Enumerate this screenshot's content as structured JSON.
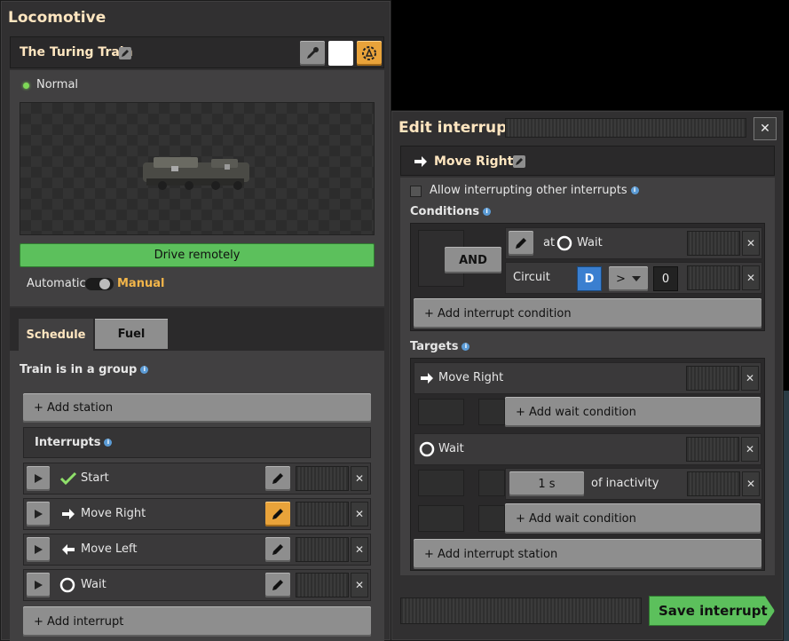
{
  "locomotive": {
    "window_title": "Locomotive",
    "train_name": "The Turing Train",
    "status": "Normal",
    "status_color": "#7ed957",
    "drive_remotely": "Drive remotely",
    "mode_automatic": "Automatic",
    "mode_manual": "Manual",
    "tabs": [
      {
        "label": "Schedule"
      },
      {
        "label": "Fuel"
      }
    ],
    "group_text": "Train is in a group",
    "add_station": "+ Add station",
    "interrupts_header": "Interrupts",
    "interrupts": [
      {
        "label": "Start",
        "icon": "check-icon"
      },
      {
        "label": "Move Right",
        "icon": "arrow-right-icon"
      },
      {
        "label": "Move Left",
        "icon": "arrow-left-icon"
      },
      {
        "label": "Wait",
        "icon": "circle-icon"
      }
    ],
    "add_interrupt": "+ Add interrupt"
  },
  "edit_interrupt": {
    "window_title": "Edit interrupt",
    "close": "✕",
    "name": "Move Right",
    "allow_interrupting": "Allow interrupting other interrupts",
    "conditions_label": "Conditions",
    "and_label": "AND",
    "cond1_at": "at",
    "cond1_station": "Wait",
    "cond2_label": "Circuit",
    "cond2_signal": "D",
    "cond2_op": ">",
    "cond2_value": "0",
    "add_interrupt_condition": "+ Add interrupt condition",
    "targets_label": "Targets",
    "target1": "Move Right",
    "add_wait_condition": "+ Add wait condition",
    "target2": "Wait",
    "inactivity_value": "1 s",
    "inactivity_label": "of inactivity",
    "add_interrupt_station": "+ Add interrupt station",
    "save": "Save interrupt"
  }
}
